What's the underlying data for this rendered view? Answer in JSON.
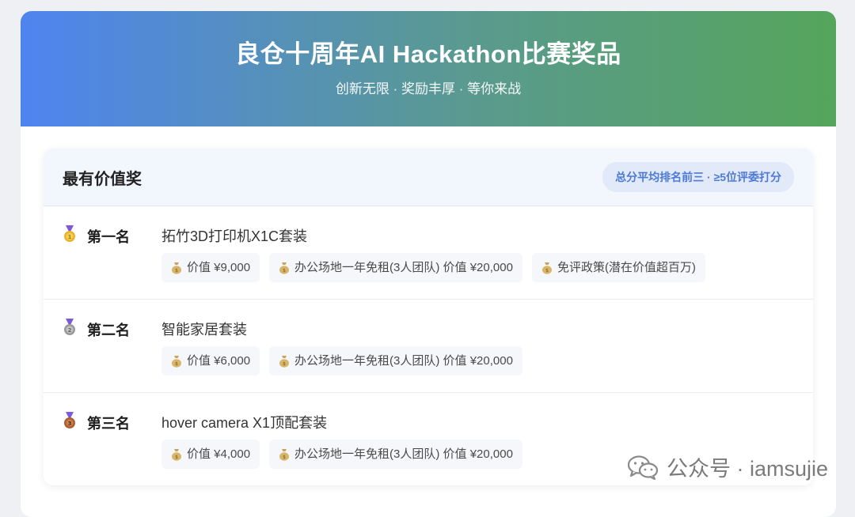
{
  "header": {
    "title": "良仓十周年AI Hackathon比赛奖品",
    "subtitle": "创新无限 · 奖励丰厚 · 等你来战"
  },
  "section": {
    "title": "最有价值奖",
    "tag": "总分平均排名前三 · ≥5位评委打分",
    "rows": [
      {
        "rank": "第一名",
        "medal": "gold-medal-icon",
        "prize": "拓竹3D打印机X1C套装",
        "chips": [
          "价值 ¥9,000",
          "办公场地一年免租(3人团队) 价值 ¥20,000",
          "免评政策(潜在价值超百万)"
        ]
      },
      {
        "rank": "第二名",
        "medal": "silver-medal-icon",
        "prize": "智能家居套装",
        "chips": [
          "价值 ¥6,000",
          "办公场地一年免租(3人团队) 价值 ¥20,000"
        ]
      },
      {
        "rank": "第三名",
        "medal": "bronze-medal-icon",
        "prize": "hover camera X1顶配套装",
        "chips": [
          "价值 ¥4,000",
          "办公场地一年免租(3人团队) 价值 ¥20,000"
        ]
      }
    ]
  },
  "colors": {
    "gold": "#e8b52a",
    "silver": "#9a9a9a",
    "bronze": "#b0653a",
    "accent": "#4c7ad6"
  },
  "watermark": {
    "text": "公众号 · iamsujie",
    "icon": "wechat-icon"
  }
}
